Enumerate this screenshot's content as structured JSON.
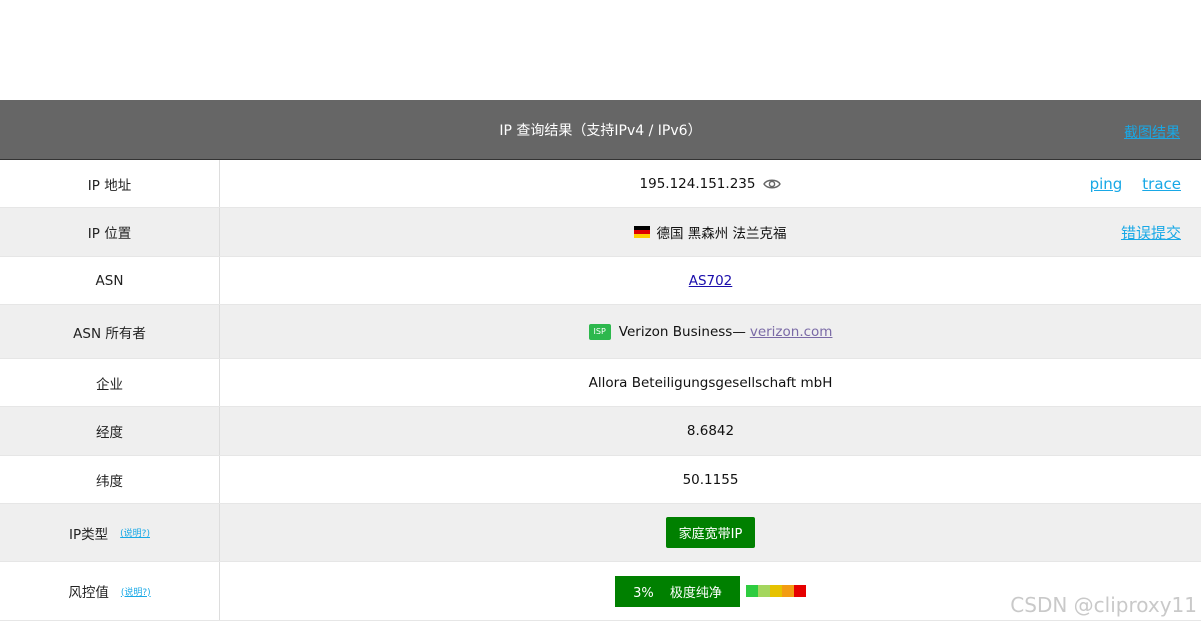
{
  "header": {
    "title": "IP 查询结果（支持IPv4 / IPv6）",
    "screenshot_link": "截图结果"
  },
  "rows": {
    "ip": {
      "label": "IP 地址",
      "value": "195.124.151.235",
      "links": [
        "ping",
        "trace"
      ]
    },
    "location": {
      "label": "IP 位置",
      "value": "德国 黑森州 法兰克福",
      "report_link": "错误提交"
    },
    "asn": {
      "label": "ASN",
      "value": "AS702"
    },
    "asn_owner": {
      "label": "ASN 所有者",
      "badge": "ISP",
      "name": "Verizon Business—",
      "domain": "verizon.com"
    },
    "company": {
      "label": "企业",
      "value": "Allora Beteiligungsgesellschaft mbH"
    },
    "longitude": {
      "label": "经度",
      "value": "8.6842"
    },
    "latitude": {
      "label": "纬度",
      "value": "50.1155"
    },
    "ip_type": {
      "label": "IP类型",
      "help": "(说明?)",
      "value": "家庭宽带IP"
    },
    "risk": {
      "label": "风控值",
      "help": "(说明?)",
      "percent": "3%",
      "level": "极度纯净"
    }
  },
  "colors": {
    "header_bg": "#666666",
    "link": "#18a8e6",
    "badge_green": "#008000",
    "meter": [
      "#2ecc40",
      "#a4d65e",
      "#e6c200",
      "#f39c12",
      "#e60000"
    ]
  },
  "watermark": "CSDN @cliproxy11"
}
